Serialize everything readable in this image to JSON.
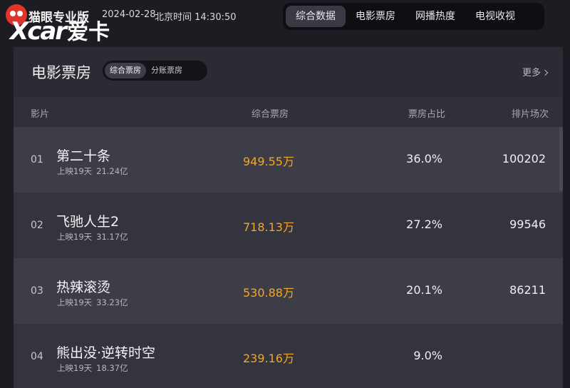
{
  "header": {
    "brand": "猫眼专业版",
    "date": "2024-02-28",
    "clock": "北京时间 14:30:50",
    "watermark_latin": "Xcar",
    "watermark_cn": "爱卡",
    "nav": [
      {
        "label": "综合数据",
        "active": true
      },
      {
        "label": "电影票房",
        "active": false
      },
      {
        "label": "网播热度",
        "active": false
      },
      {
        "label": "电视收视",
        "active": false
      }
    ]
  },
  "panel": {
    "title": "电影票房",
    "segments": [
      {
        "label": "综合票房",
        "active": true
      },
      {
        "label": "分账票房",
        "active": false
      }
    ],
    "more_label": "更多"
  },
  "table": {
    "columns": [
      "影片",
      "综合票房",
      "票房占比",
      "排片场次"
    ],
    "rows": [
      {
        "rank": "01",
        "name": "第二十条",
        "days": "上映19天",
        "total": "21.24亿",
        "box": "949.55万",
        "ratio": "36.0%",
        "shows": "100202"
      },
      {
        "rank": "02",
        "name": "飞驰人生2",
        "days": "上映19天",
        "total": "31.17亿",
        "box": "718.13万",
        "ratio": "27.2%",
        "shows": "99546"
      },
      {
        "rank": "03",
        "name": "热辣滚烫",
        "days": "上映19天",
        "total": "33.23亿",
        "box": "530.88万",
        "ratio": "20.1%",
        "shows": "86211"
      },
      {
        "rank": "04",
        "name": "熊出没·逆转时空",
        "days": "上映19天",
        "total": "18.37亿",
        "box": "239.16万",
        "ratio": "9.0%",
        "shows": ""
      }
    ]
  },
  "colors": {
    "accent_box": "#f5a623",
    "logo": "#e0352b",
    "panel_bg": "#2b2b33",
    "row_odd": "#3d3d48",
    "row_even": "#34343e"
  }
}
